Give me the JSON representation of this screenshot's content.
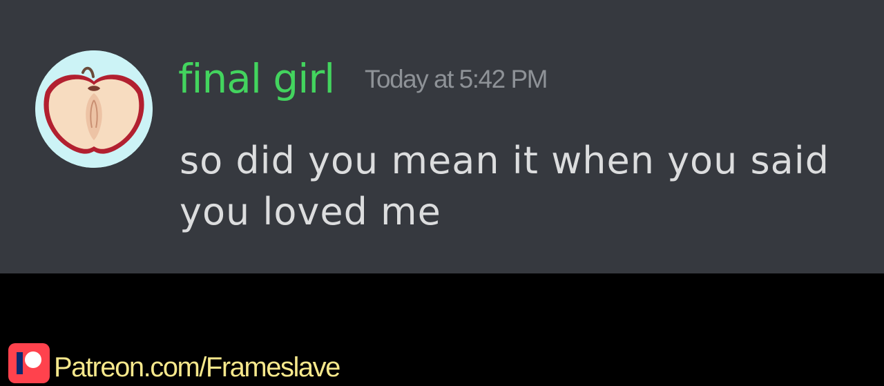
{
  "message": {
    "username": "final girl",
    "username_color": "#43d45e",
    "timestamp": "Today at 5:42 PM",
    "text": "so did you mean it when you said you loved me",
    "avatar_icon": "apple-half-icon"
  },
  "watermark": {
    "icon": "patreon-icon",
    "text": "Patreon.com/Frameslave",
    "text_color": "#f6e88c"
  },
  "colors": {
    "chat_background": "#36393f",
    "message_text": "#dcddde",
    "timestamp_text": "#8e9297",
    "letterbox": "#000000"
  }
}
